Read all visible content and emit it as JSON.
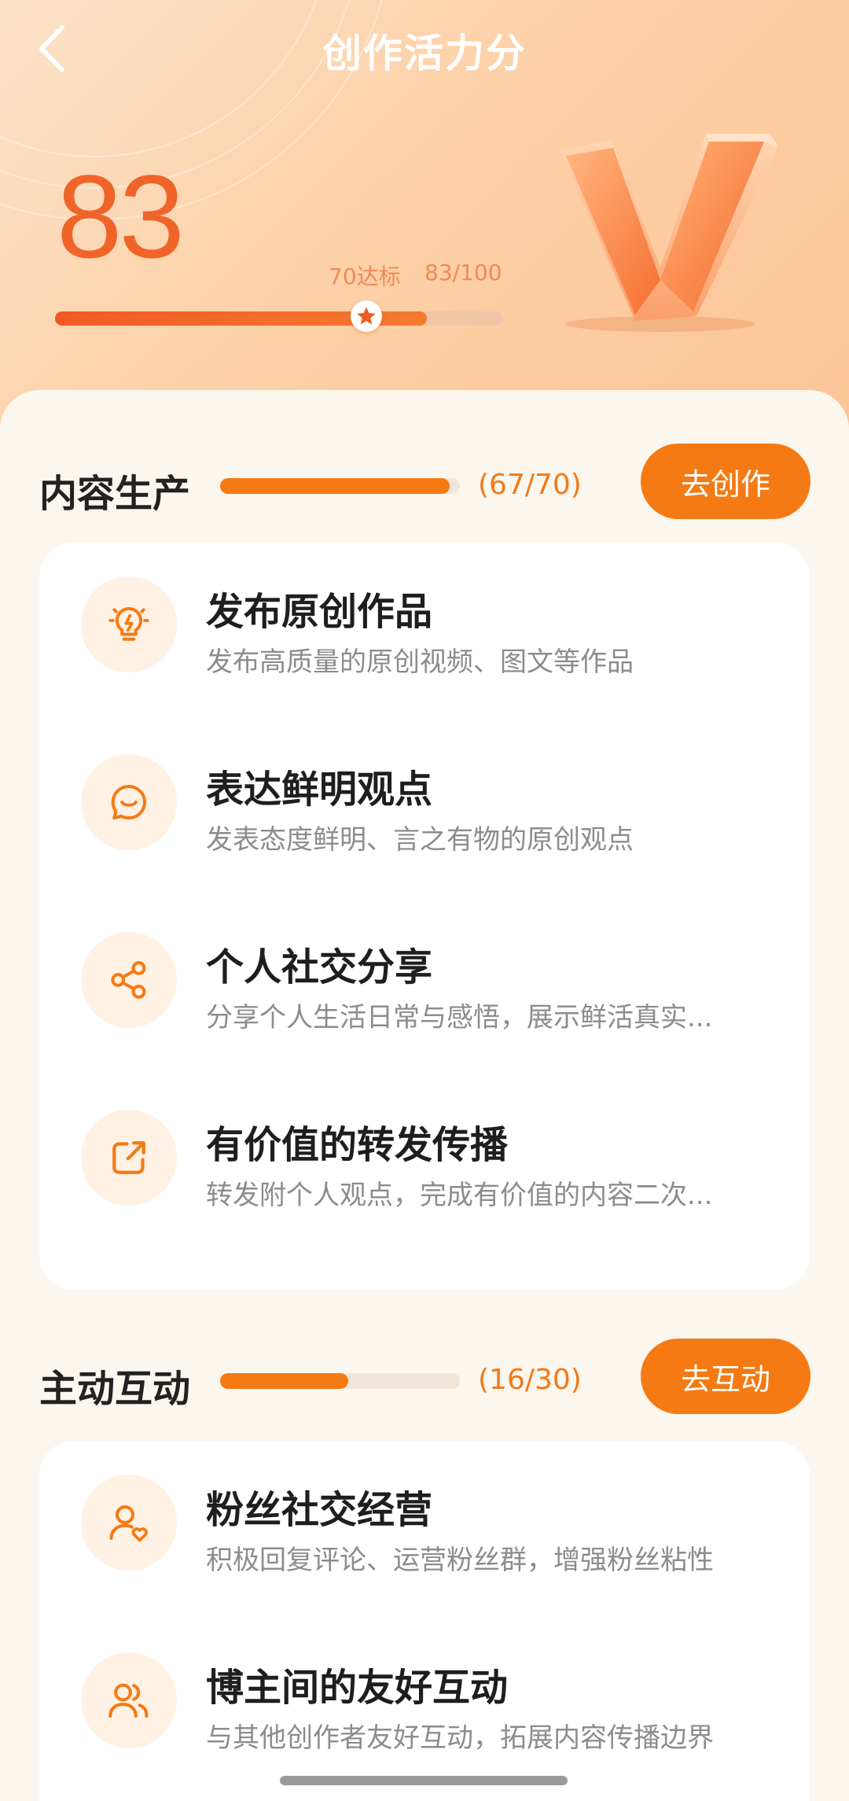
{
  "header": {
    "title": "创作活力分",
    "score": "83",
    "threshold_label": "70达标",
    "ratio_label": "83/100",
    "score_fraction": 0.83,
    "threshold_fraction": 0.7
  },
  "sections": [
    {
      "title": "内容生产",
      "progress_text": "(67/70)",
      "fraction": 0.957,
      "button": "去创作",
      "items": [
        {
          "icon": "lightbulb-icon",
          "title": "发布原创作品",
          "desc": "发布高质量的原创视频、图文等作品"
        },
        {
          "icon": "chat-smile-icon",
          "title": "表达鲜明观点",
          "desc": "发表态度鲜明、言之有物的原创观点"
        },
        {
          "icon": "share-icon",
          "title": "个人社交分享",
          "desc": "分享个人生活日常与感悟，展示鲜活真实..."
        },
        {
          "icon": "forward-icon",
          "title": "有价值的转发传播",
          "desc": "转发附个人观点，完成有价值的内容二次..."
        }
      ]
    },
    {
      "title": "主动互动",
      "progress_text": "(16/30)",
      "fraction": 0.533,
      "button": "去互动",
      "items": [
        {
          "icon": "fan-heart-icon",
          "title": "粉丝社交经营",
          "desc": "积极回复评论、运营粉丝群，增强粉丝粘性"
        },
        {
          "icon": "users-icon",
          "title": "博主间的友好互动",
          "desc": "与其他创作者友好互动，拓展内容传播边界"
        }
      ]
    }
  ],
  "colors": {
    "accent": "#f57a13",
    "score": "#f0642a",
    "header_bg": "#fdd1a8"
  }
}
